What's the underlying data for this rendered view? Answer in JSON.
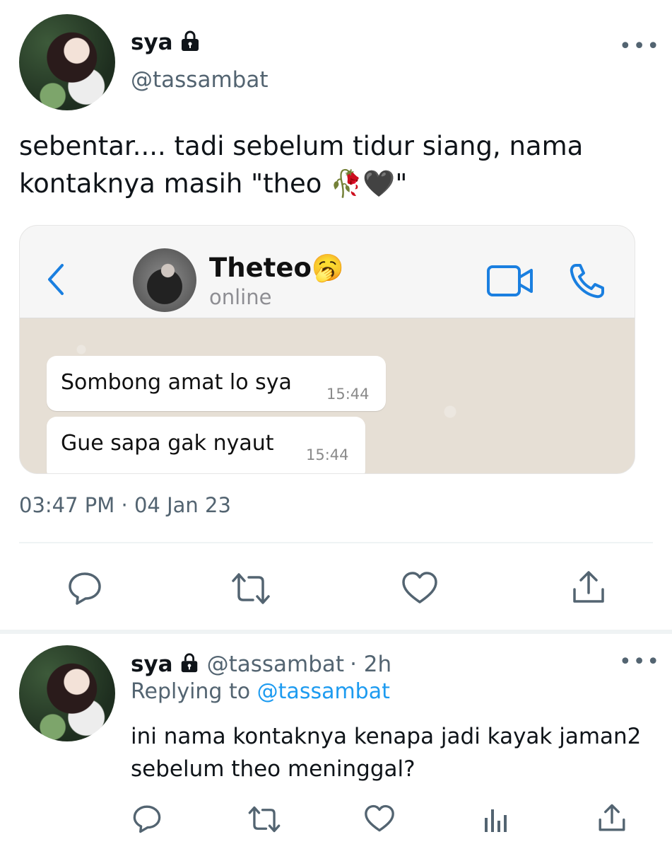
{
  "tweet": {
    "author_name": "sya",
    "author_handle": "@tassambat",
    "more_label": "•••",
    "text_line1": "sebentar.... tadi sebelum tidur siang, nama",
    "text_line2": "kontaknya masih \"theo 🥀🖤\"",
    "timestamp": "03:47 PM · 04 Jan 23"
  },
  "whatsapp": {
    "contact_name": "Theteo🥱",
    "status": "online",
    "messages": [
      {
        "text": "Sombong amat lo sya",
        "time": "15:44"
      },
      {
        "text": "Gue sapa gak nyaut",
        "time": "15:44"
      }
    ],
    "accent_color": "#1a7fe0"
  },
  "reply": {
    "author_name": "sya",
    "author_handle": "@tassambat",
    "age": "· 2h",
    "replying_prefix": "Replying to ",
    "replying_handle": "@tassambat",
    "text_line1": "ini nama kontaknya kenapa jadi kayak jaman2",
    "text_line2": "sebelum theo meninggal?",
    "more_label": "•••"
  },
  "icons": [
    "lock-icon",
    "more-icon",
    "back-icon",
    "video-call-icon",
    "phone-icon",
    "reply-icon",
    "retweet-icon",
    "like-icon",
    "share-icon",
    "analytics-icon"
  ],
  "colors": {
    "link": "#1d9bf0",
    "secondary_text": "#536471",
    "icon": "#536471"
  }
}
